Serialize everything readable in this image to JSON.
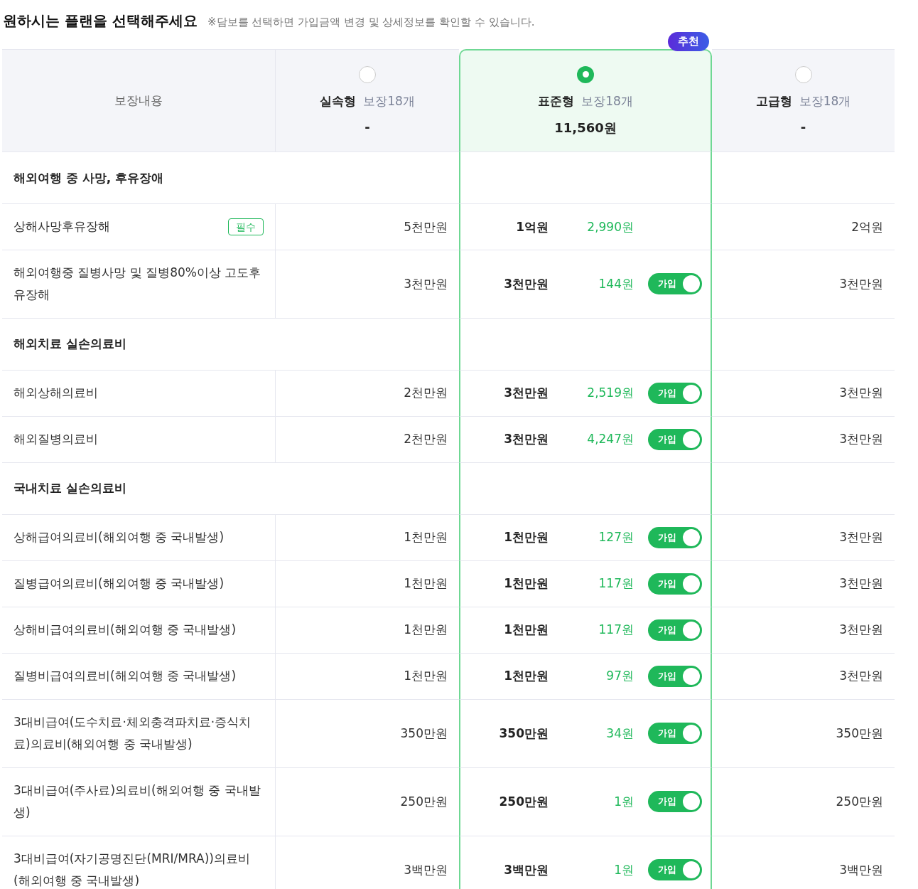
{
  "heading": {
    "title": "원하시는 플랜을 선택해주세요",
    "note": "※담보를 선택하면 가입금액 변경 및 상세정보를 확인할 수 있습니다."
  },
  "coverage_header": "보장내용",
  "plans": [
    {
      "name": "실속형",
      "count": "보장18개",
      "price": "-",
      "selected": false
    },
    {
      "name": "표준형",
      "count": "보장18개",
      "price": "11,560원",
      "selected": true,
      "badge": "추천"
    },
    {
      "name": "고급형",
      "count": "보장18개",
      "price": "-",
      "selected": false
    }
  ],
  "rows": [
    {
      "kind": "section",
      "title": "해외여행 중 사망, 후유장애"
    },
    {
      "kind": "item",
      "name": "상해사망후유장해",
      "tag": "필수",
      "cells": [
        {
          "amount": "5천만원"
        },
        {
          "amount": "1억원",
          "premium": "2,990원"
        },
        {
          "amount": "2억원"
        }
      ]
    },
    {
      "kind": "item",
      "name": "해외여행중 질병사망 및 질병80%이상 고도후유장해",
      "cells": [
        {
          "amount": "3천만원"
        },
        {
          "amount": "3천만원",
          "premium": "144원",
          "toggle": {
            "label": "가입",
            "on": true
          }
        },
        {
          "amount": "3천만원"
        }
      ]
    },
    {
      "kind": "section",
      "title": "해외치료 실손의료비"
    },
    {
      "kind": "item",
      "name": "해외상해의료비",
      "cells": [
        {
          "amount": "2천만원"
        },
        {
          "amount": "3천만원",
          "premium": "2,519원",
          "toggle": {
            "label": "가입",
            "on": true
          }
        },
        {
          "amount": "3천만원"
        }
      ]
    },
    {
      "kind": "item",
      "name": "해외질병의료비",
      "cells": [
        {
          "amount": "2천만원"
        },
        {
          "amount": "3천만원",
          "premium": "4,247원",
          "toggle": {
            "label": "가입",
            "on": true
          }
        },
        {
          "amount": "3천만원"
        }
      ]
    },
    {
      "kind": "section",
      "title": "국내치료 실손의료비"
    },
    {
      "kind": "item",
      "name": "상해급여의료비(해외여행 중 국내발생)",
      "cells": [
        {
          "amount": "1천만원"
        },
        {
          "amount": "1천만원",
          "premium": "127원",
          "toggle": {
            "label": "가입",
            "on": true
          }
        },
        {
          "amount": "3천만원"
        }
      ]
    },
    {
      "kind": "item",
      "name": "질병급여의료비(해외여행 중 국내발생)",
      "cells": [
        {
          "amount": "1천만원"
        },
        {
          "amount": "1천만원",
          "premium": "117원",
          "toggle": {
            "label": "가입",
            "on": true
          }
        },
        {
          "amount": "3천만원"
        }
      ]
    },
    {
      "kind": "item",
      "name": "상해비급여의료비(해외여행 중 국내발생)",
      "cells": [
        {
          "amount": "1천만원"
        },
        {
          "amount": "1천만원",
          "premium": "117원",
          "toggle": {
            "label": "가입",
            "on": true
          }
        },
        {
          "amount": "3천만원"
        }
      ]
    },
    {
      "kind": "item",
      "name": "질병비급여의료비(해외여행 중 국내발생)",
      "cells": [
        {
          "amount": "1천만원"
        },
        {
          "amount": "1천만원",
          "premium": "97원",
          "toggle": {
            "label": "가입",
            "on": true
          }
        },
        {
          "amount": "3천만원"
        }
      ]
    },
    {
      "kind": "item",
      "name": "3대비급여(도수치료·체외충격파치료·증식치료)의료비(해외여행 중 국내발생)",
      "cells": [
        {
          "amount": "350만원"
        },
        {
          "amount": "350만원",
          "premium": "34원",
          "toggle": {
            "label": "가입",
            "on": true
          }
        },
        {
          "amount": "350만원"
        }
      ]
    },
    {
      "kind": "item",
      "name": "3대비급여(주사료)의료비(해외여행 중 국내발생)",
      "cells": [
        {
          "amount": "250만원"
        },
        {
          "amount": "250만원",
          "premium": "1원",
          "toggle": {
            "label": "가입",
            "on": true
          }
        },
        {
          "amount": "250만원"
        }
      ]
    },
    {
      "kind": "item",
      "name": "3대비급여(자기공명진단(MRI/MRA))의료비(해외여행 중 국내발생)",
      "cells": [
        {
          "amount": "3백만원"
        },
        {
          "amount": "3백만원",
          "premium": "1원",
          "toggle": {
            "label": "가입",
            "on": true
          }
        },
        {
          "amount": "3백만원"
        }
      ]
    }
  ]
}
